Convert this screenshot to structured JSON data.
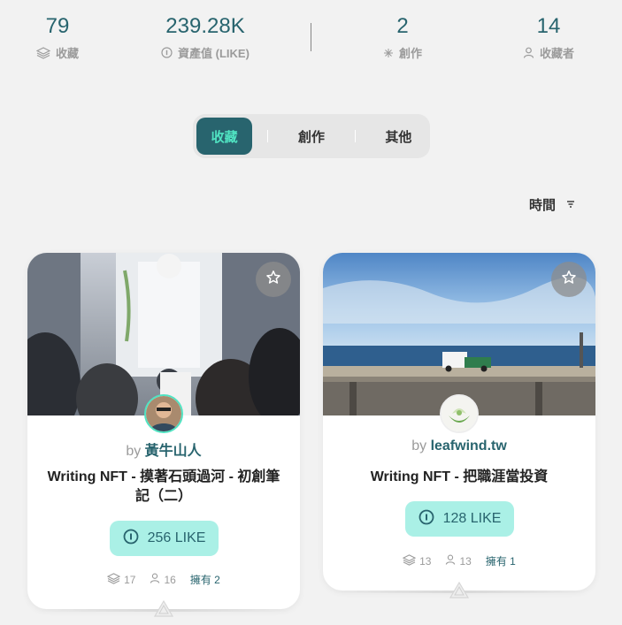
{
  "stats": [
    {
      "value": "79",
      "label": "收藏",
      "icon": "layers-icon"
    },
    {
      "value": "239.28K",
      "label": "資產值 (LIKE)",
      "icon": "like-coin-icon"
    },
    {
      "value": "2",
      "label": "創作",
      "icon": "sparkle-icon"
    },
    {
      "value": "14",
      "label": "收藏者",
      "icon": "person-icon"
    }
  ],
  "tabs": [
    {
      "label": "收藏",
      "active": true
    },
    {
      "label": "創作",
      "active": false
    },
    {
      "label": "其他",
      "active": false
    }
  ],
  "sort": {
    "label": "時間"
  },
  "cards": [
    {
      "by": "by",
      "author": "黃牛山人",
      "title": "Writing NFT - 摸著石頭過河 - 初創筆記（二）",
      "like_amount": "256 LIKE",
      "collections": "17",
      "collectors": "16",
      "owned": "擁有 2"
    },
    {
      "by": "by",
      "author": "leafwind.tw",
      "title": "Writing NFT - 把職涯當投資",
      "like_amount": "128 LIKE",
      "collections": "13",
      "collectors": "13",
      "owned": "擁有 1"
    }
  ],
  "colors": {
    "primary": "#28646e",
    "accent": "#50e3c2",
    "like_bg": "#aaf0e6",
    "page_bg": "#f2f2f2"
  }
}
